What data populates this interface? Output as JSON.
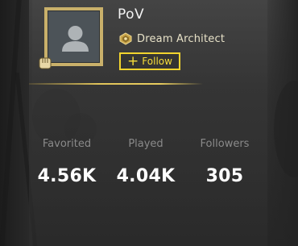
{
  "profile": {
    "name": "PoV",
    "title": "Dream Architect",
    "follow_label": "Follow",
    "follow_symbol": "+",
    "avatar_icon": "default-user-silhouette",
    "badge_icon": "fist-badge",
    "title_icon": "architect-emblem"
  },
  "stats": [
    {
      "label": "Favorited",
      "value": "4.56K"
    },
    {
      "label": "Played",
      "value": "4.04K"
    },
    {
      "label": "Followers",
      "value": "305"
    }
  ],
  "colors": {
    "accent_gold": "#e0c35a",
    "follow_yellow": "#f2d42e",
    "stat_label": "#8a8a8a",
    "stat_value": "#ffffff"
  }
}
